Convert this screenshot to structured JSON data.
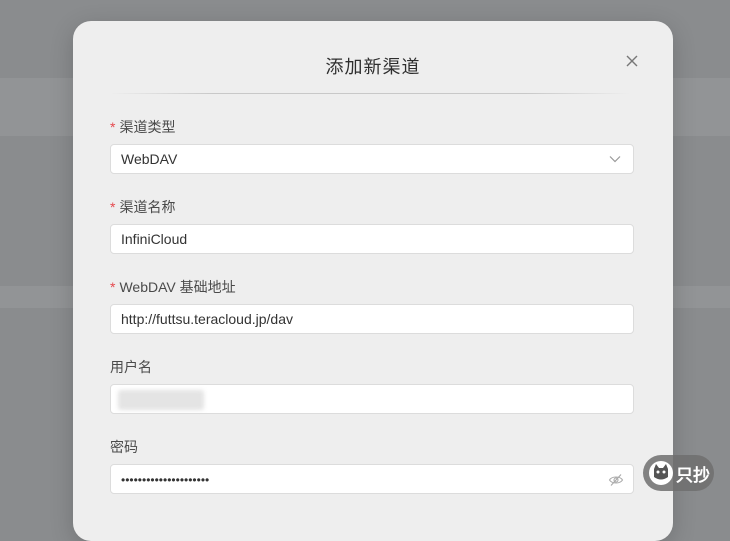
{
  "dialog": {
    "title": "添加新渠道"
  },
  "form": {
    "channel_type": {
      "required_mark": "*",
      "label": "渠道类型",
      "value": "WebDAV"
    },
    "channel_name": {
      "required_mark": "*",
      "label": "渠道名称",
      "value": "InfiniCloud"
    },
    "base_url": {
      "required_mark": "*",
      "label": "WebDAV 基础地址",
      "value": "http://futtsu.teracloud.jp/dav"
    },
    "username": {
      "label": "用户名",
      "value_hidden": true
    },
    "password": {
      "label": "密码",
      "value": "•••••••••••••••••••••"
    }
  },
  "icons": {
    "close": "close-icon",
    "select_arrow": "chevron-down-icon",
    "password_toggle": "eye-off-icon",
    "watermark_logo": "cat-logo-icon"
  },
  "watermark": {
    "text": "只抄"
  },
  "colors": {
    "required": "#e5484d",
    "dialog_bg": "#eeeeee",
    "overlay": "#8a8c8e"
  }
}
